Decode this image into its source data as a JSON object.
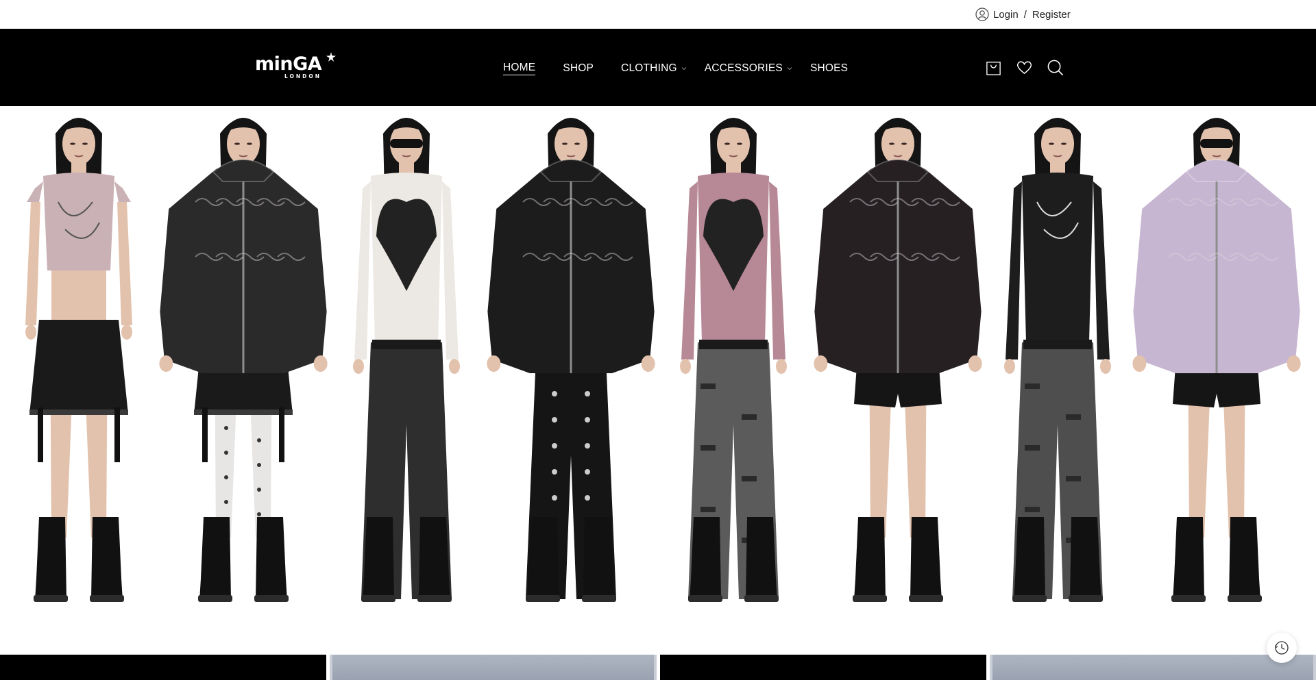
{
  "topbar": {
    "login_label": "Login",
    "separator": "/",
    "register_label": "Register",
    "icon": "user-icon"
  },
  "header": {
    "logo_text": "minGA",
    "logo_subtext": "LONDON",
    "nav": [
      {
        "label": "HOME",
        "active": true,
        "has_dropdown": false
      },
      {
        "label": "SHOP",
        "active": false,
        "has_dropdown": false
      },
      {
        "label": "CLOTHING",
        "active": false,
        "has_dropdown": true
      },
      {
        "label": "ACCESSORIES",
        "active": false,
        "has_dropdown": true
      },
      {
        "label": "SHOES",
        "active": false,
        "has_dropdown": false
      }
    ],
    "icons": [
      "cart-icon",
      "heart-icon",
      "search-icon"
    ]
  },
  "hero": {
    "models": [
      {
        "top": "pink graphic tee",
        "top_color": "#c9b1b6",
        "bottom": "black skirt",
        "bottom_color": "#1a1a1a",
        "legs": "skin",
        "shoes": "black boots"
      },
      {
        "top": "black zip hoodie",
        "top_color": "#2a2a2a",
        "bottom": "black skirt",
        "bottom_color": "#1a1a1a",
        "legs": "white tights",
        "shoes": "black boots"
      },
      {
        "top": "white wing print top",
        "top_color": "#ece8e3",
        "bottom": "black flared jeans",
        "bottom_color": "#2e2e2e",
        "legs": "jeans",
        "shoes": "black boots"
      },
      {
        "top": "black fleece jacket",
        "top_color": "#1c1c1c",
        "bottom": "black patterned tights",
        "bottom_color": "#151515",
        "legs": "tights",
        "shoes": "black boots"
      },
      {
        "top": "pink wing print top",
        "top_color": "#b78896",
        "bottom": "grey ripped jeans",
        "bottom_color": "#5b5b5b",
        "legs": "jeans",
        "shoes": "black boots"
      },
      {
        "top": "black patterned hoodie",
        "top_color": "#262023",
        "bottom": "black shorts",
        "bottom_color": "#151515",
        "legs": "skin",
        "shoes": "black boots"
      },
      {
        "top": "black long sleeve",
        "top_color": "#1d1d1d",
        "bottom": "grey ripped jeans",
        "bottom_color": "#4e4e4e",
        "legs": "jeans",
        "shoes": "black boots"
      },
      {
        "top": "lilac zip hoodie",
        "top_color": "#c7b6d1",
        "bottom": "black shorts",
        "bottom_color": "#151515",
        "legs": "skin",
        "shoes": "black boots"
      }
    ]
  },
  "strip": {
    "tiles": [
      "dark",
      "light",
      "dark",
      "light"
    ]
  },
  "fab": {
    "icon": "history-icon"
  },
  "colors": {
    "header_bg": "#000000",
    "header_text": "#ffffff",
    "page_bg": "#ffffff",
    "skin": "#e3c2ad",
    "hair": "#141414"
  }
}
